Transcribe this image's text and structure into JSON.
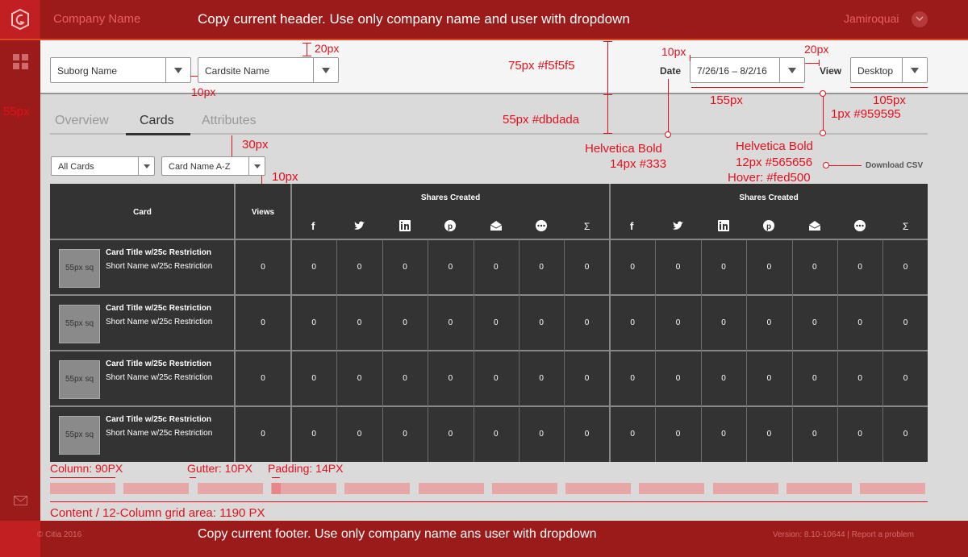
{
  "header": {
    "company": "Company Name",
    "note": "Copy current header. Use only company name and user with dropdown",
    "user": "Jamiroquai"
  },
  "filters": {
    "suborg": "Suborg Name",
    "cardsite": "Cardsite Name",
    "date_label": "Date",
    "date_value": "7/26/16 – 8/2/16",
    "view_label": "View",
    "view_value": "Desktop"
  },
  "tabs": {
    "overview": "Overview",
    "cards": "Cards",
    "attributes": "Attributes"
  },
  "subfilters": {
    "all_cards": "All Cards",
    "sort": "Card Name A-Z",
    "download": "Download CSV"
  },
  "table": {
    "col_card": "Card",
    "col_views": "Views",
    "group1": "Shares Created",
    "group2": "Shares Created",
    "sigma": "Σ",
    "rows": [
      {
        "thumb": "55px sq",
        "title": "Card Title w/25c Restriction",
        "sub": "Short Name w/25c Restriction",
        "values": [
          "0",
          "0",
          "0",
          "0",
          "0",
          "0",
          "0",
          "0",
          "0",
          "0",
          "0",
          "0",
          "0",
          "0",
          "0"
        ]
      },
      {
        "thumb": "55px sq",
        "title": "Card Title w/25c Restriction",
        "sub": "Short Name w/25c Restriction",
        "values": [
          "0",
          "0",
          "0",
          "0",
          "0",
          "0",
          "0",
          "0",
          "0",
          "0",
          "0",
          "0",
          "0",
          "0",
          "0"
        ]
      },
      {
        "thumb": "55px sq",
        "title": "Card Title w/25c Restriction",
        "sub": "Short Name w/25c Restriction",
        "values": [
          "0",
          "0",
          "0",
          "0",
          "0",
          "0",
          "0",
          "0",
          "0",
          "0",
          "0",
          "0",
          "0",
          "0",
          "0"
        ]
      },
      {
        "thumb": "55px sq",
        "title": "Card Title w/25c Restriction",
        "sub": "Short Name w/25c Restriction",
        "values": [
          "0",
          "0",
          "0",
          "0",
          "0",
          "0",
          "0",
          "0",
          "0",
          "0",
          "0",
          "0",
          "0",
          "0",
          "0"
        ]
      }
    ]
  },
  "annotations": {
    "a20a": "20px",
    "a10a": "10px",
    "a75": "75px #f5f5f5",
    "a55": "55px #dbdada",
    "a55side": "55px",
    "a10b": "10px",
    "a20b": "20px",
    "a155": "155px",
    "a105": "105px",
    "a1px": "1px #959595",
    "hb1": "Helvetica Bold",
    "hb1s": "14px #333",
    "hb2": "Helvetica Bold",
    "hb2s": "12px #565656",
    "hover": "Hover: #fed500",
    "a30": "30px",
    "a10c": "10px",
    "column": "Column: 90PX",
    "gutter": "Gutter: 10PX",
    "padding": "Padding: 14PX",
    "content": "Content / 12-Column grid area: 1190 PX"
  },
  "footer": {
    "copyright": "© Citia 2016",
    "note": "Copy current footer. Use only company name ans user with dropdown",
    "version": "Version: 8.10-10644 | Report a problem"
  },
  "colors": {
    "header": "#9b1a1a",
    "accent": "#c21f23",
    "annotation": "#e4101c",
    "table": "#333333",
    "grid": "#e8a7a7"
  }
}
